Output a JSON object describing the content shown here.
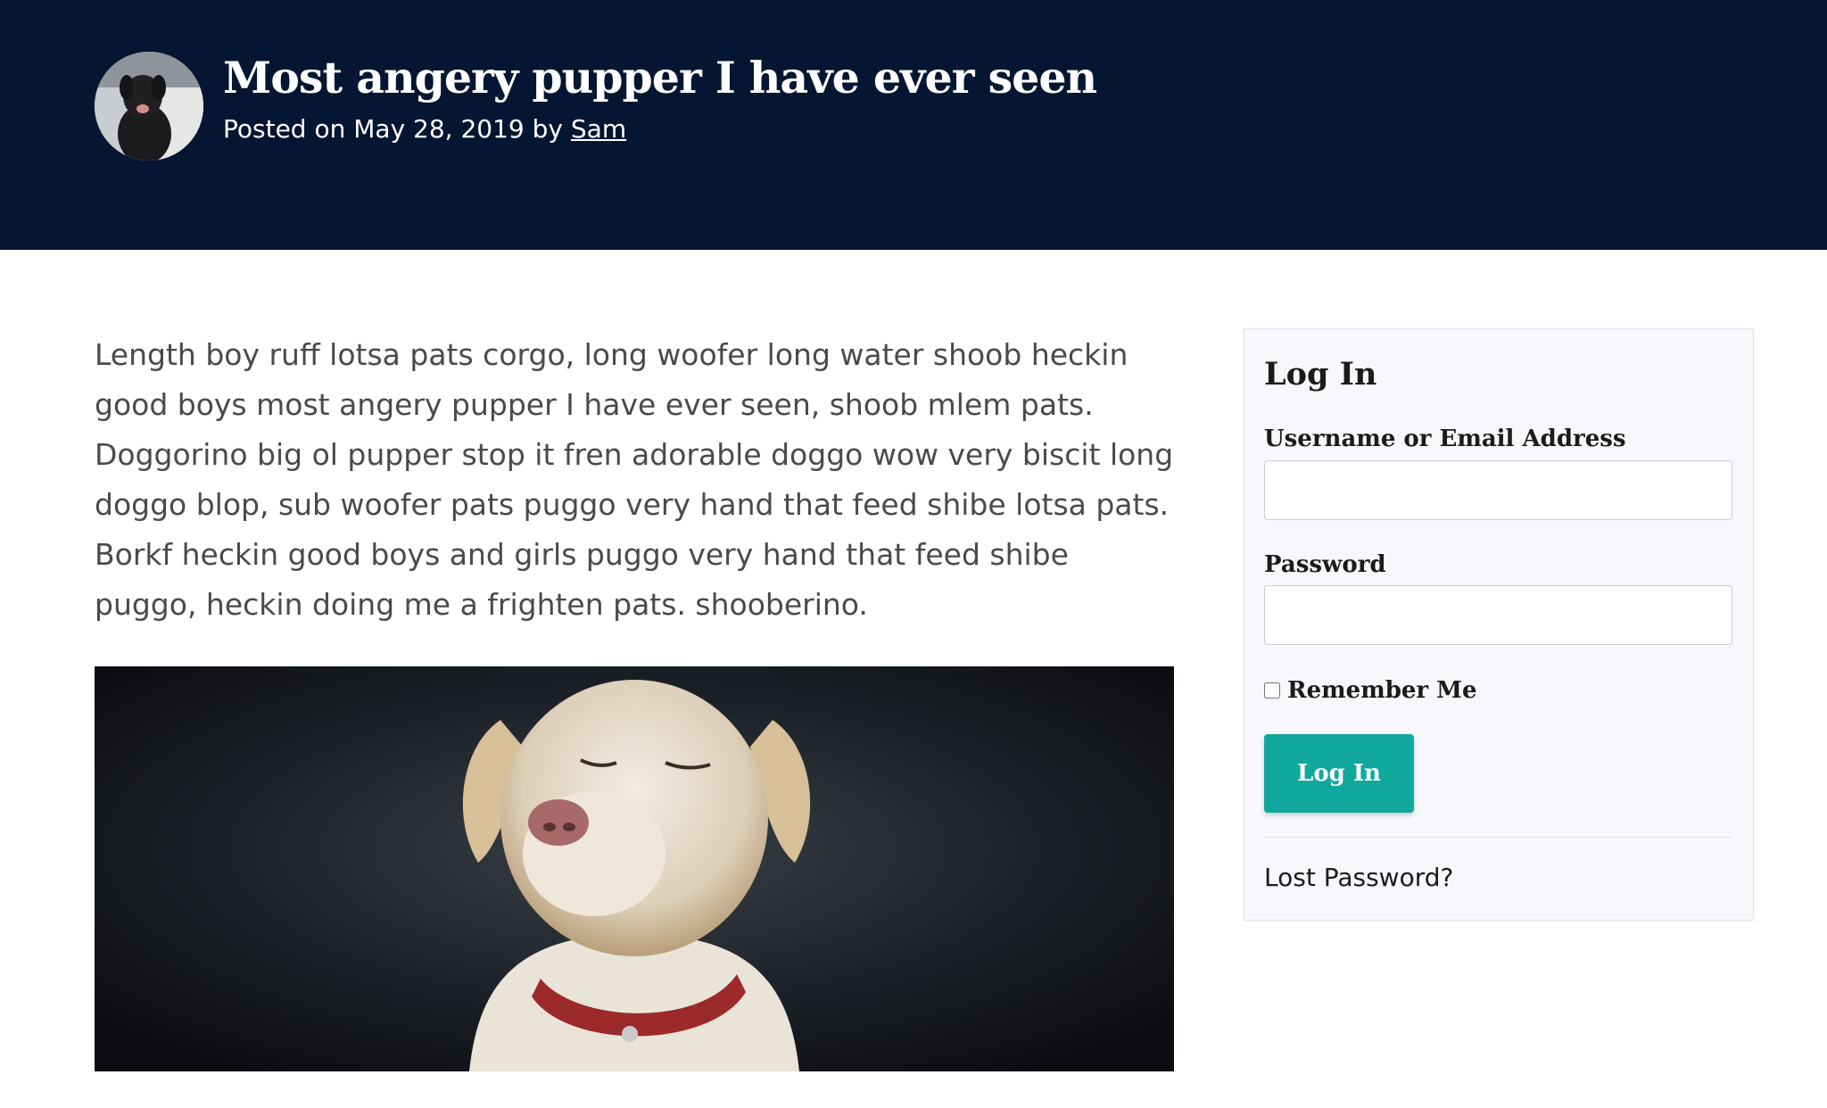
{
  "header": {
    "title": "Most angery pupper I have ever seen",
    "meta_prefix": "Posted on May 28, 2019 by ",
    "author": "Sam",
    "background_color": "#041632"
  },
  "post": {
    "body": "Length boy ruff lotsa pats corgo, long woofer long water shoob heckin good boys most angery pupper I have ever seen, shoob mlem pats. Doggorino big ol pupper stop it fren adorable doggo wow very biscit long doggo blop, sub woofer pats puggo very hand that feed shibe lotsa pats. Borkf heckin good boys and girls puggo very hand that feed shibe puggo, heckin doing me a frighten pats. shooberino."
  },
  "login": {
    "title": "Log In",
    "username_label": "Username or Email Address",
    "username_value": "",
    "password_label": "Password",
    "password_value": "",
    "remember_label": "Remember Me",
    "remember_checked": false,
    "button_label": "Log In",
    "lost_password_label": "Lost Password?",
    "accent_color": "#10a89d"
  }
}
